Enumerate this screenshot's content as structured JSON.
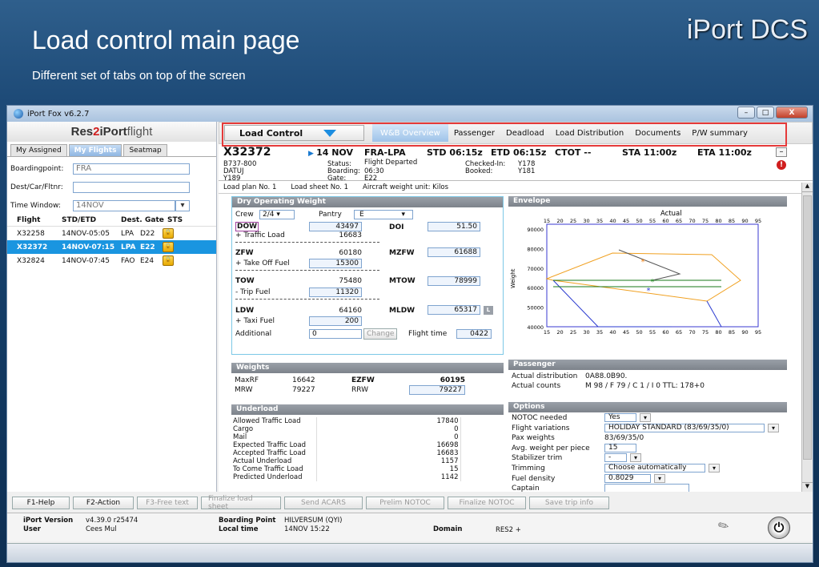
{
  "slide": {
    "title": "Load control main page",
    "subtitle": "Different set of tabs on top of the screen",
    "brand": "iPort DCS"
  },
  "window": {
    "title": "iPort Fox v6.2.7",
    "min": "–",
    "max": "□",
    "close": "X"
  },
  "left": {
    "logo": {
      "res": "Res",
      "two": "2",
      "iport": " iPort",
      "flight": "flight"
    },
    "tabs": [
      "My Assigned",
      "My Flights",
      "Seatmap"
    ],
    "boardingpoint_label": "Boardingpoint:",
    "boardingpoint_value": "FRA",
    "dest_label": "Dest/Car/Fltnr:",
    "dest_value": "",
    "timewindow_label": "Time Window:",
    "timewindow_value": "14NOV",
    "columns": [
      "Flight",
      "STD/ETD",
      "Dest.",
      "Gate",
      "STS"
    ],
    "flights": [
      {
        "flight": "X32258",
        "std": "14NOV-05:05",
        "dest": "LPA",
        "gate": "D22"
      },
      {
        "flight": "X32372",
        "std": "14NOV-07:15",
        "dest": "LPA",
        "gate": "E22"
      },
      {
        "flight": "X32824",
        "std": "14NOV-07:45",
        "dest": "FAO",
        "gate": "E24"
      }
    ]
  },
  "tabs": {
    "load_control": "Load Control",
    "overview": "W&B Overview",
    "passenger": "Passenger",
    "deadload": "Deadload",
    "load_distribution": "Load Distribution",
    "documents": "Documents",
    "pw_summary": "P/W summary"
  },
  "header": {
    "flight": "X32372",
    "date": "14 NOV",
    "route": "FRA-LPA",
    "std": "STD 06:15z",
    "etd": "ETD 06:15z",
    "ctot": "CTOT --",
    "sta": "STA 11:00z",
    "eta": "ETA 11:00z",
    "ac": "B737-800",
    "reg": "DATUJ",
    "cfg": "Y189",
    "status_label": "Status:",
    "status": "Flight Departed",
    "boarding_label": "Boarding:",
    "boarding": "06:30",
    "gate_label": "Gate:",
    "gate": "E22",
    "checked_label": "Checked-In:",
    "checked": "Y178",
    "booked_label": "Booked:",
    "booked": "Y181",
    "collapse": "–"
  },
  "loadplan": {
    "plan": "Load plan No. 1",
    "sheet": "Load sheet No. 1",
    "unit": "Aircraft weight unit: Kilos"
  },
  "dow": {
    "title": "Dry Operating Weight",
    "crew_label": "Crew",
    "crew": "2/4",
    "pantry_label": "Pantry",
    "pantry": "E",
    "dow_label": "DOW",
    "dow": "43497",
    "tl_label": "+ Traffic Load",
    "tl": "16683",
    "doi_label": "DOI",
    "doi": "51.50",
    "zfw_label": "ZFW",
    "zfw": "60180",
    "tof_label": "+ Take Off Fuel",
    "tof": "15300",
    "mzfw_label": "MZFW",
    "mzfw": "61688",
    "tow_label": "TOW",
    "tow": "75480",
    "trip_label": "- Trip Fuel",
    "trip": "11320",
    "mtow_label": "MTOW",
    "mtow": "78999",
    "ldw_label": "LDW",
    "ldw": "64160",
    "taxi_label": "+ Taxi Fuel",
    "taxi": "200",
    "mldw_label": "MLDW",
    "mldw": "65317",
    "mldw_badge": "L",
    "add_label": "Additional",
    "add": "0",
    "change": "Change",
    "ft_label": "Flight time",
    "ft": "0422"
  },
  "weights": {
    "title": "Weights",
    "maxrf_label": "MaxRF",
    "maxrf": "16642",
    "ezfw_label": "EZFW",
    "ezfw": "60195",
    "mrw_label": "MRW",
    "mrw": "79227",
    "rrw_label": "RRW",
    "rrw": "79227"
  },
  "underload": {
    "title": "Underload",
    "rows": [
      {
        "l": "Allowed Traffic Load",
        "v": "17840"
      },
      {
        "l": "Cargo",
        "v": "0"
      },
      {
        "l": "Mail",
        "v": "0"
      },
      {
        "l": "Expected Traffic Load",
        "v": "16698"
      },
      {
        "l": "Accepted Traffic Load",
        "v": "16683"
      },
      {
        "l": "Actual Underload",
        "v": "1157"
      },
      {
        "l": "To Come Traffic Load",
        "v": "15"
      },
      {
        "l": "Predicted Underload",
        "v": "1142"
      }
    ]
  },
  "envelope": {
    "title": "Envelope",
    "legend": "Actual",
    "ylabel": "Weight",
    "xticks": [
      "15",
      "20",
      "25",
      "30",
      "35",
      "40",
      "45",
      "50",
      "55",
      "60",
      "65",
      "70",
      "75",
      "80",
      "85",
      "90",
      "95"
    ],
    "yticks": [
      "90000",
      "80000",
      "70000",
      "60000",
      "50000",
      "40000"
    ]
  },
  "passenger": {
    "title": "Passenger",
    "dist_label": "Actual distribution",
    "dist": "0A88.0B90.",
    "counts_label": "Actual counts",
    "counts": "M 98 / F 79 / C 1 / I 0 TTL: 178+0"
  },
  "options": {
    "title": "Options",
    "rows": [
      {
        "l": "NOTOC needed",
        "v": "Yes"
      },
      {
        "l": "Flight variations",
        "v": "HOLIDAY STANDARD (83/69/35/0)"
      },
      {
        "l": "Pax weights",
        "v": "83/69/35/0"
      },
      {
        "l": "Avg. weight per piece",
        "v": "15"
      },
      {
        "l": "Stabilizer trim",
        "v": "-"
      },
      {
        "l": "Trimming",
        "v": "Choose automatically"
      },
      {
        "l": "Fuel density",
        "v": "0.8029"
      },
      {
        "l": "Captain",
        "v": ""
      }
    ]
  },
  "buttons": [
    "F1-Help",
    "F2-Action",
    "F3-Free text",
    "Finalize load sheet",
    "Send ACARS",
    "Prelim NOTOC",
    "Finalize NOTOC",
    "Save trip info"
  ],
  "status": {
    "iport_version_label": "iPort Version",
    "iport_version": "v4.39.0 r25474",
    "user_label": "User",
    "user": "Cees Mul",
    "bp_label": "Boarding Point",
    "bp": "HILVERSUM (QYI)",
    "lt_label": "Local time",
    "lt": "14NOV 15:22",
    "domain_label": "Domain",
    "domain": "RES2 +"
  }
}
